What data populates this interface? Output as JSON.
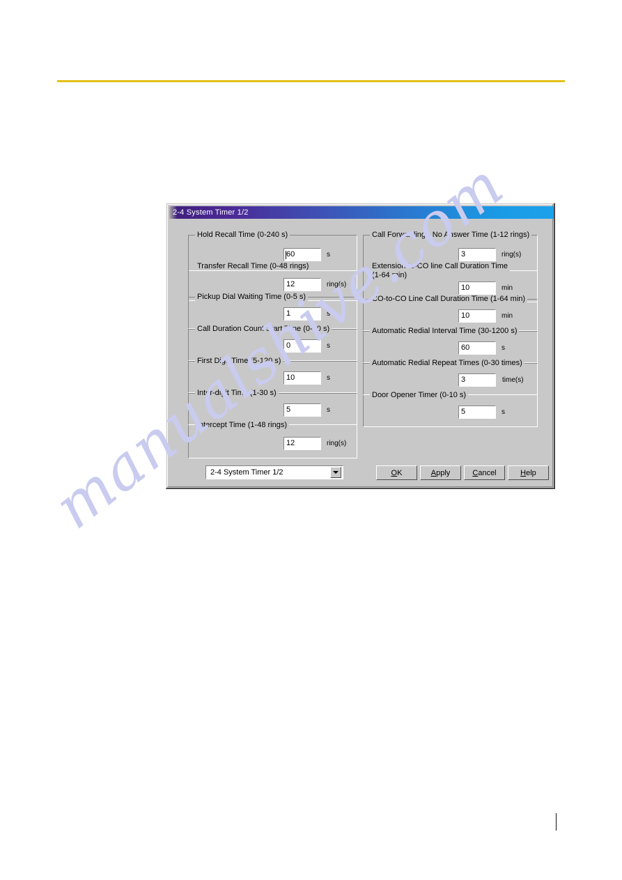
{
  "page": {
    "rule_color": "#e3c119",
    "watermark_text": "manualshive.com",
    "watermark_color": "#c9cbef"
  },
  "dialog": {
    "title": "2-4 System Timer 1/2",
    "titlebar_gradient_start": "#3d1e80",
    "titlebar_gradient_end": "#1ba2ea",
    "face_color": "#c8c8c8",
    "left_column": [
      {
        "legend": "Hold Recall Time (0-240 s)",
        "value": "60",
        "unit": "s",
        "caret": true
      },
      {
        "legend": "Transfer Recall Time (0-48 rings)",
        "value": "12",
        "unit": "ring(s)",
        "caret": false
      },
      {
        "legend": "Pickup Dial Waiting Time (0-5 s)",
        "value": "1",
        "unit": "s",
        "caret": false
      },
      {
        "legend": "Call Duration Count Start Time (0-60 s)",
        "value": "0",
        "unit": "s",
        "caret": false
      },
      {
        "legend": "First Digit Time (5-120 s)",
        "value": "10",
        "unit": "s",
        "caret": false
      },
      {
        "legend": "Inter-digit Time (1-30 s)",
        "value": "5",
        "unit": "s",
        "caret": false
      },
      {
        "legend": "Intercept Time (1-48 rings)",
        "value": "12",
        "unit": "ring(s)",
        "caret": false
      }
    ],
    "right_column": [
      {
        "legend": "Call Forwarding - No Answer Time (1-12 rings)",
        "value": "3",
        "unit": "ring(s)",
        "caret": false
      },
      {
        "legend": "Extension-to-CO line Call Duration Time\n (1-64 min)",
        "value": "10",
        "unit": "min",
        "caret": false
      },
      {
        "legend": "CO-to-CO Line Call Duration Time (1-64 min)",
        "value": "10",
        "unit": "min",
        "caret": false
      },
      {
        "legend": "Automatic Redial Interval Time (30-1200 s)",
        "value": "60",
        "unit": "s",
        "caret": false
      },
      {
        "legend": "Automatic Redial Repeat Times (0-30 times)",
        "value": "3",
        "unit": "time(s)",
        "caret": false
      },
      {
        "legend": "Door Opener Timer (0-10 s)",
        "value": "5",
        "unit": "s",
        "caret": false
      }
    ],
    "footer": {
      "combo_value": "2-4 System Timer 1/2",
      "buttons": [
        {
          "prefix": "",
          "acc": "O",
          "suffix": "K"
        },
        {
          "prefix": "",
          "acc": "A",
          "suffix": "pply"
        },
        {
          "prefix": "",
          "acc": "C",
          "suffix": "ancel"
        },
        {
          "prefix": "",
          "acc": "H",
          "suffix": "elp"
        }
      ]
    }
  }
}
